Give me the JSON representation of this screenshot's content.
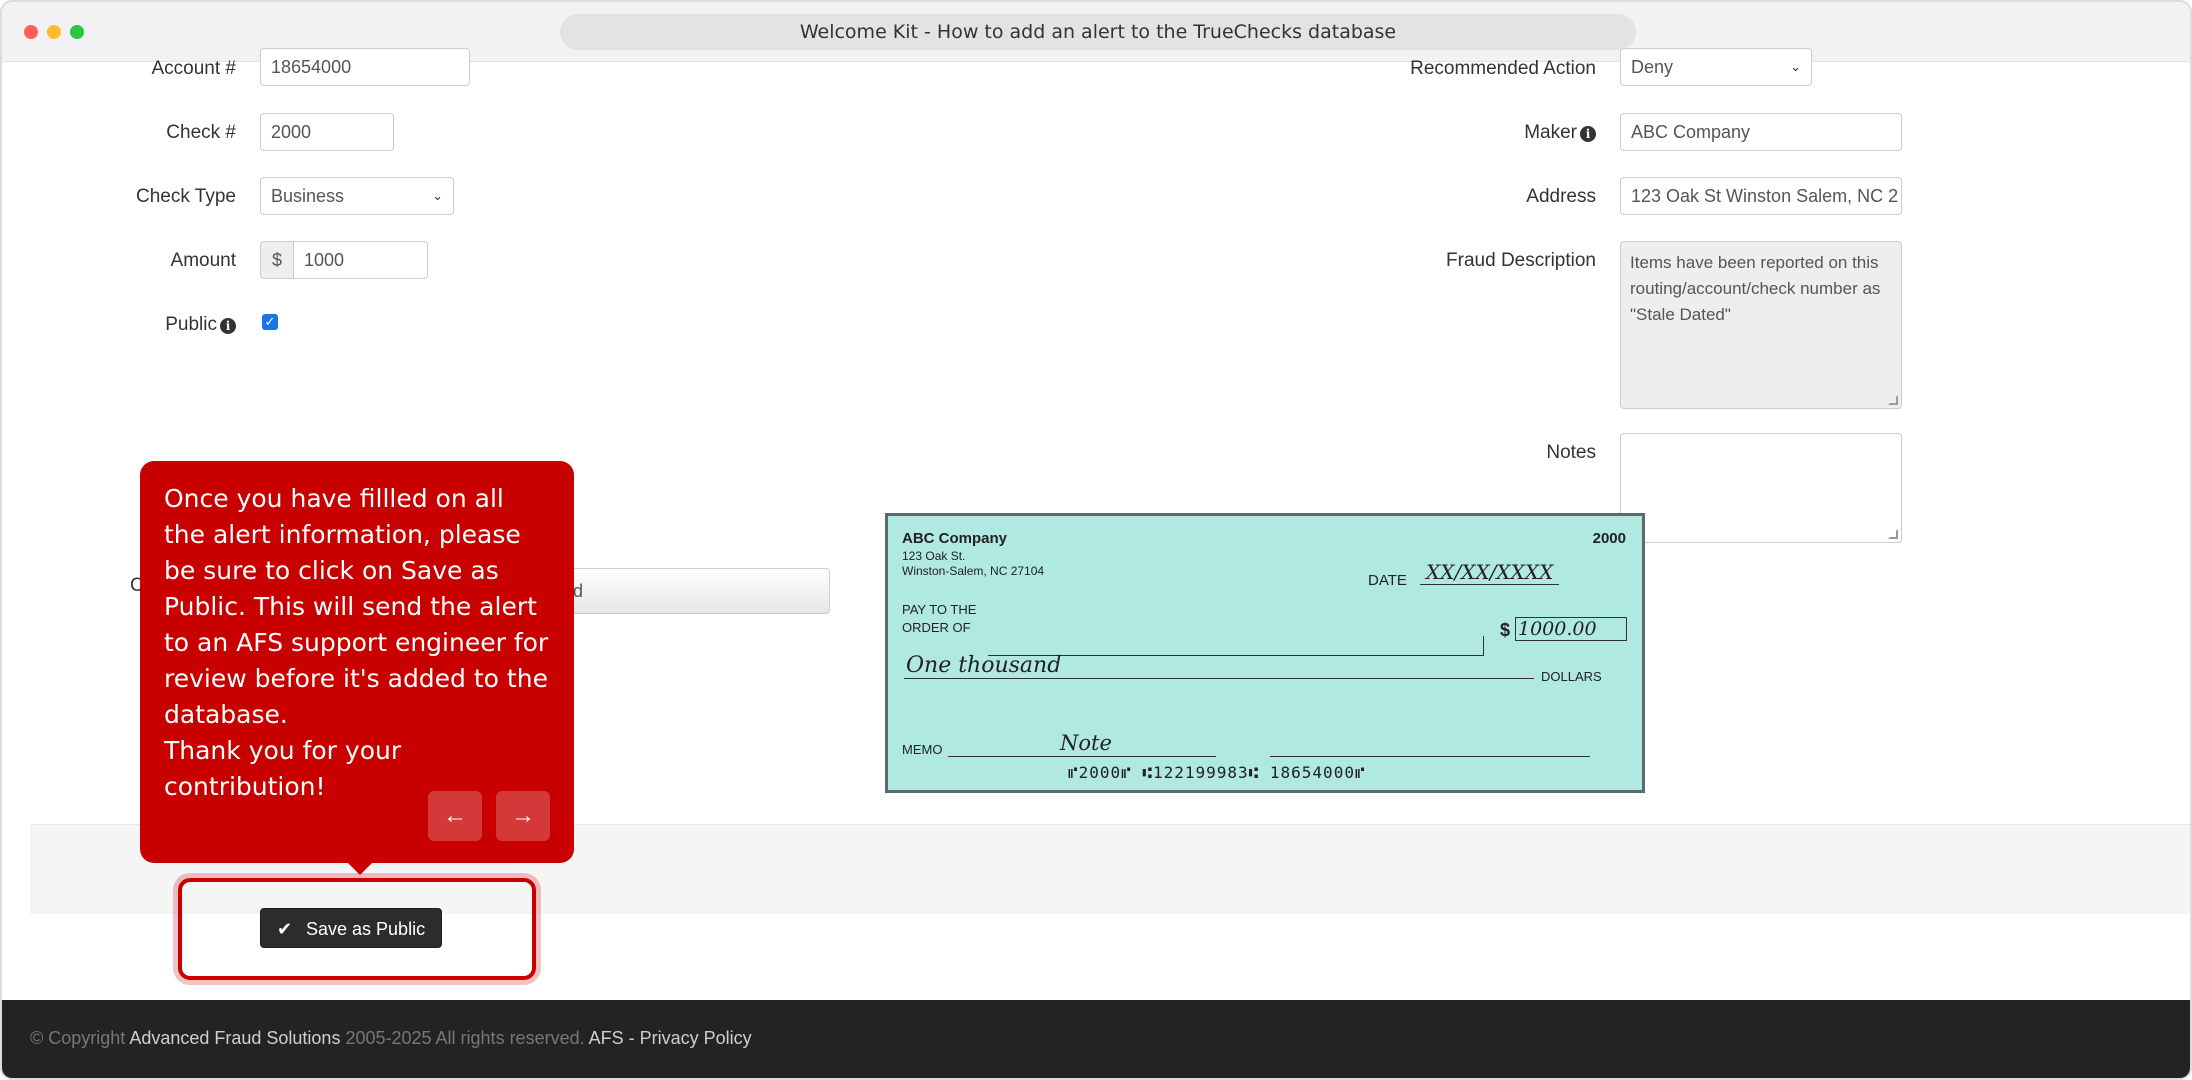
{
  "window": {
    "title": "Welcome Kit - How to add an alert to the TrueChecks database"
  },
  "form_left": {
    "account_label": "Account #",
    "account_value": "18654000",
    "check_label": "Check #",
    "check_value": "2000",
    "check_type_label": "Check Type",
    "check_type_value": "Business",
    "amount_label": "Amount",
    "amount_prefix": "$",
    "amount_value": "1000",
    "public_label": "Public",
    "public_checked": true,
    "partial_label": "C",
    "partial_field_text": "d"
  },
  "form_right": {
    "action_label": "Recommended Action",
    "action_value": "Deny",
    "maker_label": "Maker",
    "maker_value": "ABC Company",
    "address_label": "Address",
    "address_value": "123 Oak St Winston Salem, NC 2",
    "fraud_label": "Fraud Description",
    "fraud_value": "Items have been reported on this routing/account/check number as \"Stale Dated\"",
    "notes_label": "Notes",
    "notes_value": ""
  },
  "check_image": {
    "company": "ABC Company",
    "address_line1": "123 Oak St.",
    "address_line2": "Winston-Salem, NC 27104",
    "number": "2000",
    "date_label": "DATE",
    "date_value": "XX/XX/XXXX",
    "pay_to_line1": "PAY TO THE",
    "pay_to_line2": "ORDER OF",
    "dollar_sign": "$",
    "amount": "1000.00",
    "amount_words": "One thousand",
    "dollars_label": "DOLLARS",
    "memo_label": "MEMO",
    "memo_value": "Note",
    "micr": "⑈2000⑈ ⑆122199983⑆ 18654000⑈"
  },
  "tooltip": {
    "text": "Once you have fillled on all the alert information, please be sure to click on Save as Public. This will send the alert to an AFS support engineer for review before it's added to the database.\nThank you for your contribution!",
    "prev_icon": "arrow-left-icon",
    "next_icon": "arrow-right-icon"
  },
  "save": {
    "label": "Save as Public",
    "icon": "check-icon"
  },
  "footer": {
    "prefix": "© Copyright ",
    "company": "Advanced Fraud Solutions",
    "years": " 2005-2025 All rights reserved. ",
    "links": "AFS - Privacy Policy"
  },
  "colors": {
    "tooltip_bg": "#c80000",
    "check_bg": "#b0e8e2",
    "footer_bg": "#232323",
    "button_bg": "#2c2c2c"
  }
}
